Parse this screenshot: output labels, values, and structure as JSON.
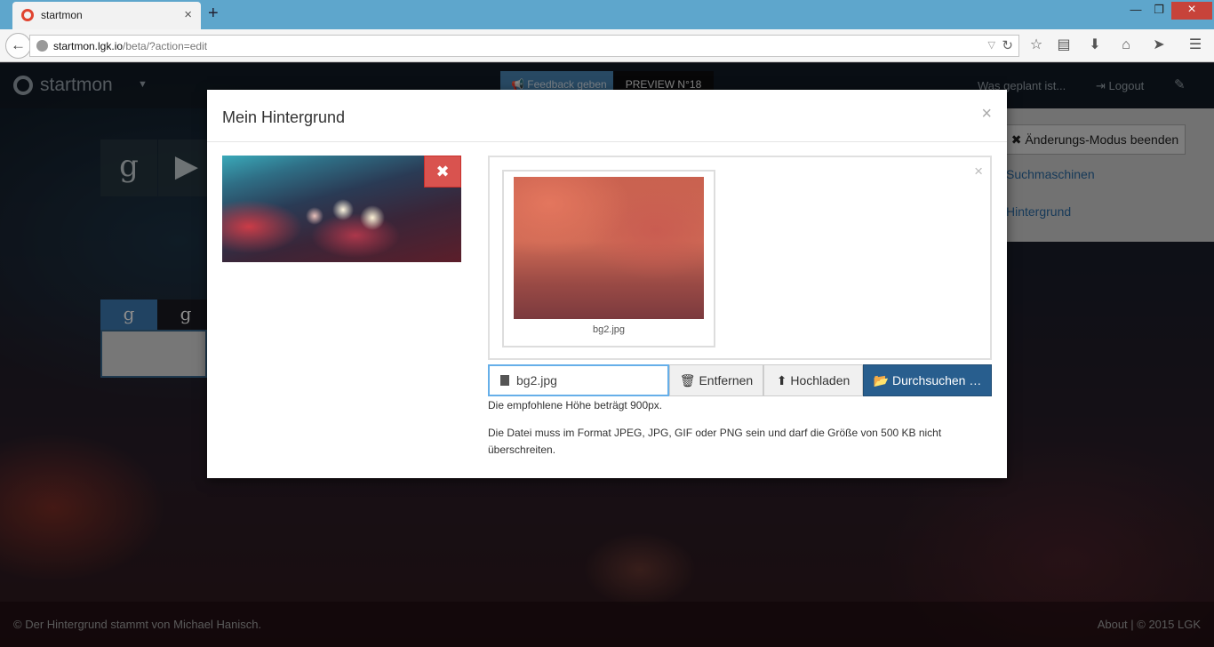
{
  "browser": {
    "tab_title": "startmon",
    "url_host": "startmon.lgk.io",
    "url_path": "/beta/?action=edit"
  },
  "app": {
    "brand": "startmon",
    "feedback_label": "Feedback geben",
    "preview_label": "PREVIEW N°18",
    "planned_label": "Was geplant ist...",
    "logout_label": "Logout"
  },
  "side_panel": {
    "end_edit_label": "Änderungs-Modus beenden",
    "links": [
      "Suchmaschinen",
      "Hintergrund"
    ]
  },
  "footer": {
    "credit": "Der Hintergrund stammt von Michael Hanisch.",
    "about": "About | © 2015 LGK"
  },
  "modal": {
    "title": "Mein Hintergrund",
    "thumb_filename": "bg2.jpg",
    "file_input_value": "bg2.jpg",
    "buttons": {
      "remove": "Entfernen",
      "upload": "Hochladen",
      "browse": "Durchsuchen …"
    },
    "help_height": "Die empfohlene Höhe beträgt 900px.",
    "help_format": "Die Datei muss im Format JPEG, JPG, GIF oder PNG sein und darf die Größe von 500 KB nicht überschreiten."
  },
  "icons": {
    "remove_bg": "times-icon",
    "trash": "trash-icon",
    "upload": "upload-circle-icon",
    "folder": "folder-open-icon"
  },
  "colors": {
    "tabbar": "#5ea6cc",
    "danger": "#d9534f",
    "primary": "#285e8e",
    "focus": "#66afe9"
  }
}
